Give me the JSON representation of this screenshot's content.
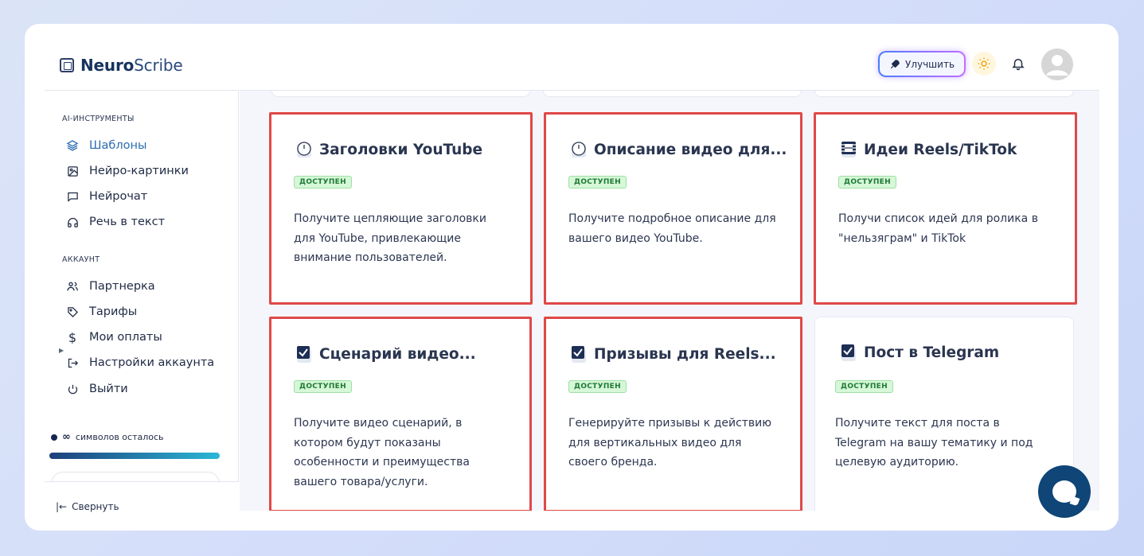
{
  "header": {
    "logo_bold": "Neuro",
    "logo_light": "Scribe",
    "upgrade_label": "Улучшить"
  },
  "sidebar": {
    "section_ai": "AI-ИНСТРУМЕНТЫ",
    "ai_items": [
      {
        "label": "Шаблоны",
        "icon": "layers-icon"
      },
      {
        "label": "Нейро-картинки",
        "icon": "image-icon"
      },
      {
        "label": "Нейрочат",
        "icon": "chat-icon"
      },
      {
        "label": "Речь в текст",
        "icon": "headphones-icon"
      }
    ],
    "section_account": "АККАУНТ",
    "account_items": [
      {
        "label": "Партнерка",
        "icon": "users-icon"
      },
      {
        "label": "Тарифы",
        "icon": "tag-icon"
      },
      {
        "label": "Мои оплаты",
        "icon": "dollar-icon"
      },
      {
        "label": "Настройки аккаунта",
        "icon": "sign-in-icon"
      },
      {
        "label": "Выйти",
        "icon": "power-icon"
      }
    ],
    "usage_symbol": "∞",
    "usage_text": "символов осталось",
    "collapse_label": "Свернуть"
  },
  "cards": [
    {
      "title": "Заголовки YouTube",
      "badge": "ДОСТУПЕН",
      "desc": "Получите цепляющие заголовки для YouTube, привлекающие внимание пользователей.",
      "icon": "clock-icon",
      "highlighted": true
    },
    {
      "title": "Описание видео для...",
      "badge": "ДОСТУПЕН",
      "desc": "Получите подробное описание для вашего видео YouTube.",
      "icon": "clock-icon",
      "highlighted": true
    },
    {
      "title": "Идеи Reels/TikTok",
      "badge": "ДОСТУПЕН",
      "desc": "Получи список идей для ролика в \"нельзяграм\" и TikTok",
      "icon": "film-icon",
      "highlighted": true
    },
    {
      "title": "Сценарий видео...",
      "badge": "ДОСТУПЕН",
      "desc": "Получите видео сценарий, в котором будут показаны особенности и преимущества вашего товара/услуги.",
      "icon": "checkbox-icon",
      "highlighted": true
    },
    {
      "title": "Призывы для Reels...",
      "badge": "ДОСТУПЕН",
      "desc": "Генерируйте призывы к действию для вертикальных видео для своего бренда.",
      "icon": "checkbox-icon",
      "highlighted": true
    },
    {
      "title": "Пост в Telegram",
      "badge": "ДОСТУПЕН",
      "desc": "Получите текст для поста в Telegram на вашу тематику и под целевую аудиторию.",
      "icon": "checkbox-icon",
      "highlighted": false
    }
  ],
  "colors": {
    "highlight": "#e04848",
    "accent": "#2b6cb0",
    "badge_bg": "#d6f7d8"
  }
}
